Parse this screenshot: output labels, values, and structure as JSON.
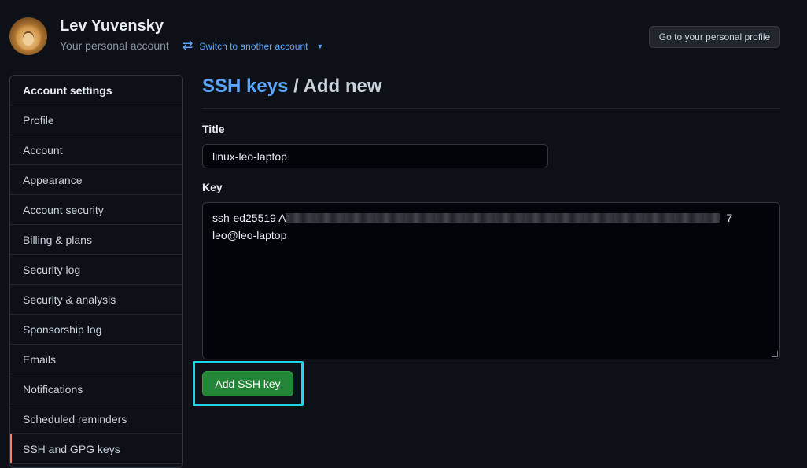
{
  "account": {
    "name": "Lev Yuvensky",
    "subtitle": "Your personal account",
    "switch_label": "Switch to another account",
    "profile_button": "Go to your personal profile"
  },
  "sidebar": {
    "heading": "Account settings",
    "items": [
      {
        "label": "Profile"
      },
      {
        "label": "Account"
      },
      {
        "label": "Appearance"
      },
      {
        "label": "Account security"
      },
      {
        "label": "Billing & plans"
      },
      {
        "label": "Security log"
      },
      {
        "label": "Security & analysis"
      },
      {
        "label": "Sponsorship log"
      },
      {
        "label": "Emails"
      },
      {
        "label": "Notifications"
      },
      {
        "label": "Scheduled reminders"
      },
      {
        "label": "SSH and GPG keys",
        "selected": true
      }
    ]
  },
  "main": {
    "breadcrumb_link": "SSH keys",
    "breadcrumb_sep": " / ",
    "breadcrumb_current": "Add new",
    "title_label": "Title",
    "title_value": "linux-leo-laptop",
    "key_label": "Key",
    "key_prefix": "ssh-ed25519 A",
    "key_suffix": "7",
    "key_comment": "leo@leo-laptop",
    "submit_label": "Add SSH key"
  },
  "colors": {
    "accent_link": "#58a6ff",
    "submit_green": "#238636",
    "focus_ring": "#1fd6e6",
    "selected_marker": "#f78166"
  }
}
